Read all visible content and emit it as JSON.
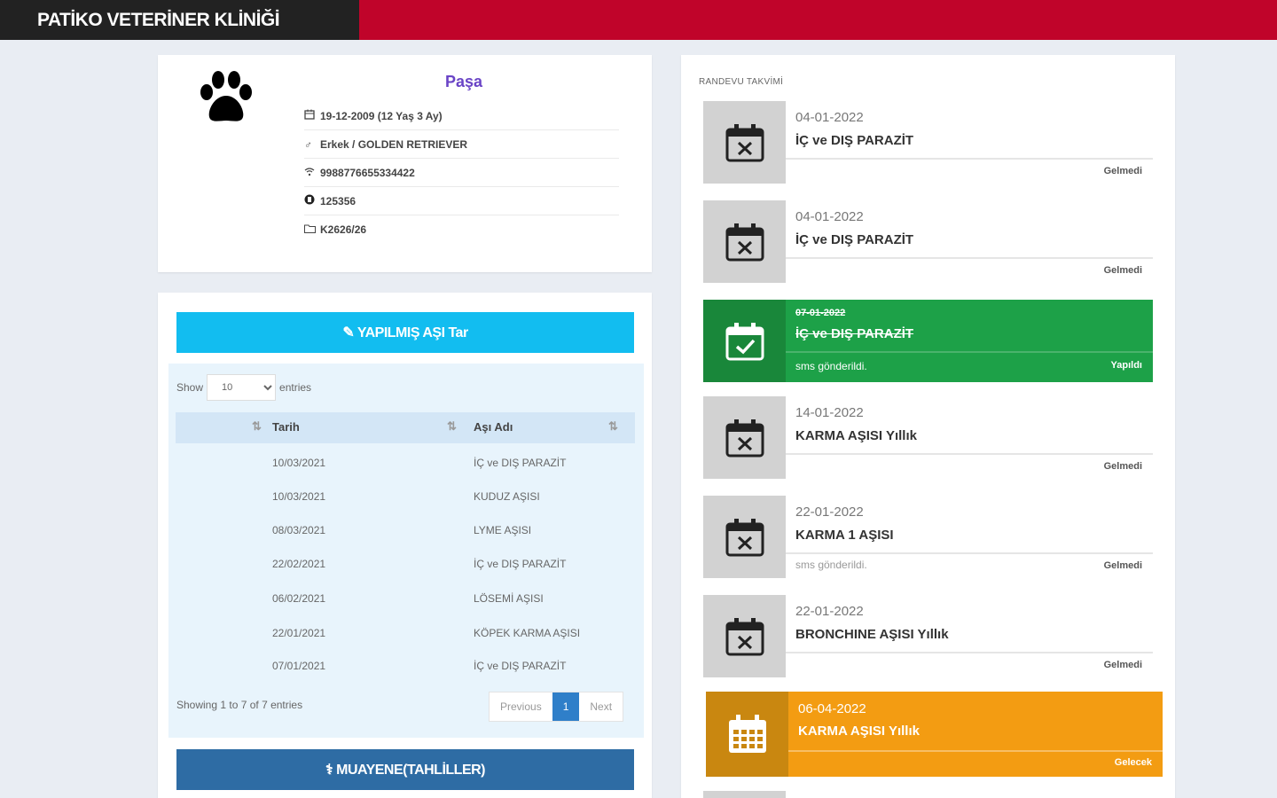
{
  "header": {
    "brand": "PATİKO VETERİNER KLİNİĞİ"
  },
  "pet": {
    "name": "Paşa",
    "birth": "19-12-2009 (12 Yaş 3 Ay)",
    "gender_breed": "Erkek / GOLDEN RETRIEVER",
    "chip": "9988776655334422",
    "id": "125356",
    "file": "K2626/26",
    "icons": [
      "paw-icon",
      "calendar-icon",
      "gender-icon",
      "chip-icon",
      "id-icon",
      "folder-icon"
    ]
  },
  "vaccines": {
    "add_button": "YAPILMIŞ AŞI Tar",
    "show_label": "Show",
    "entries_label": "entries",
    "length_value": "10",
    "columns": [
      "Tarih",
      "Aşı Adı"
    ],
    "rows": [
      {
        "date": "10/03/2021",
        "name": "İÇ ve DIŞ PARAZİT"
      },
      {
        "date": "10/03/2021",
        "name": "KUDUZ AŞISI"
      },
      {
        "date": "08/03/2021",
        "name": "LYME AŞISI"
      },
      {
        "date": "22/02/2021",
        "name": "İÇ ve DIŞ PARAZİT"
      },
      {
        "date": "06/02/2021",
        "name": "LÖSEMİ AŞISI"
      },
      {
        "date": "22/01/2021",
        "name": "KÖPEK KARMA AŞISI"
      },
      {
        "date": "07/01/2021",
        "name": "İÇ ve DIŞ PARAZİT"
      }
    ],
    "info": "Showing 1 to 7 of 7 entries",
    "pager": {
      "prev": "Previous",
      "current": "1",
      "next": "Next"
    },
    "exam_button": "MUAYENE(TAHLİLLER)"
  },
  "appointments": {
    "title": "RANDEVU TAKVİMİ",
    "items": [
      {
        "date": "04-01-2022",
        "title": "İÇ ve DIŞ PARAZİT",
        "note": "",
        "status": "Gelmedi"
      },
      {
        "date": "04-01-2022",
        "title": "İÇ ve DIŞ PARAZİT",
        "note": "",
        "status": "Gelmedi"
      },
      {
        "date": "07-01-2022",
        "title": "İÇ ve DIŞ PARAZİT",
        "note": "sms gönderildi.",
        "status": "Yapıldı"
      },
      {
        "date": "14-01-2022",
        "title": "KARMA AŞISI Yıllık",
        "note": "",
        "status": "Gelmedi"
      },
      {
        "date": "22-01-2022",
        "title": "KARMA 1 AŞISI",
        "note": "sms gönderildi.",
        "status": "Gelmedi"
      },
      {
        "date": "22-01-2022",
        "title": "BRONCHINE AŞISI Yıllık",
        "note": "",
        "status": "Gelmedi"
      },
      {
        "date": "06-04-2022",
        "title": "KARMA AŞISI Yıllık",
        "note": "",
        "status": "Gelecek"
      }
    ]
  },
  "colors": {
    "brand_red": "#c0042a",
    "add_button": "#12bdf0",
    "exam_button": "#2e6ca4",
    "done": "#1da148",
    "future": "#f39c12",
    "pet_name": "#6a44c6"
  }
}
